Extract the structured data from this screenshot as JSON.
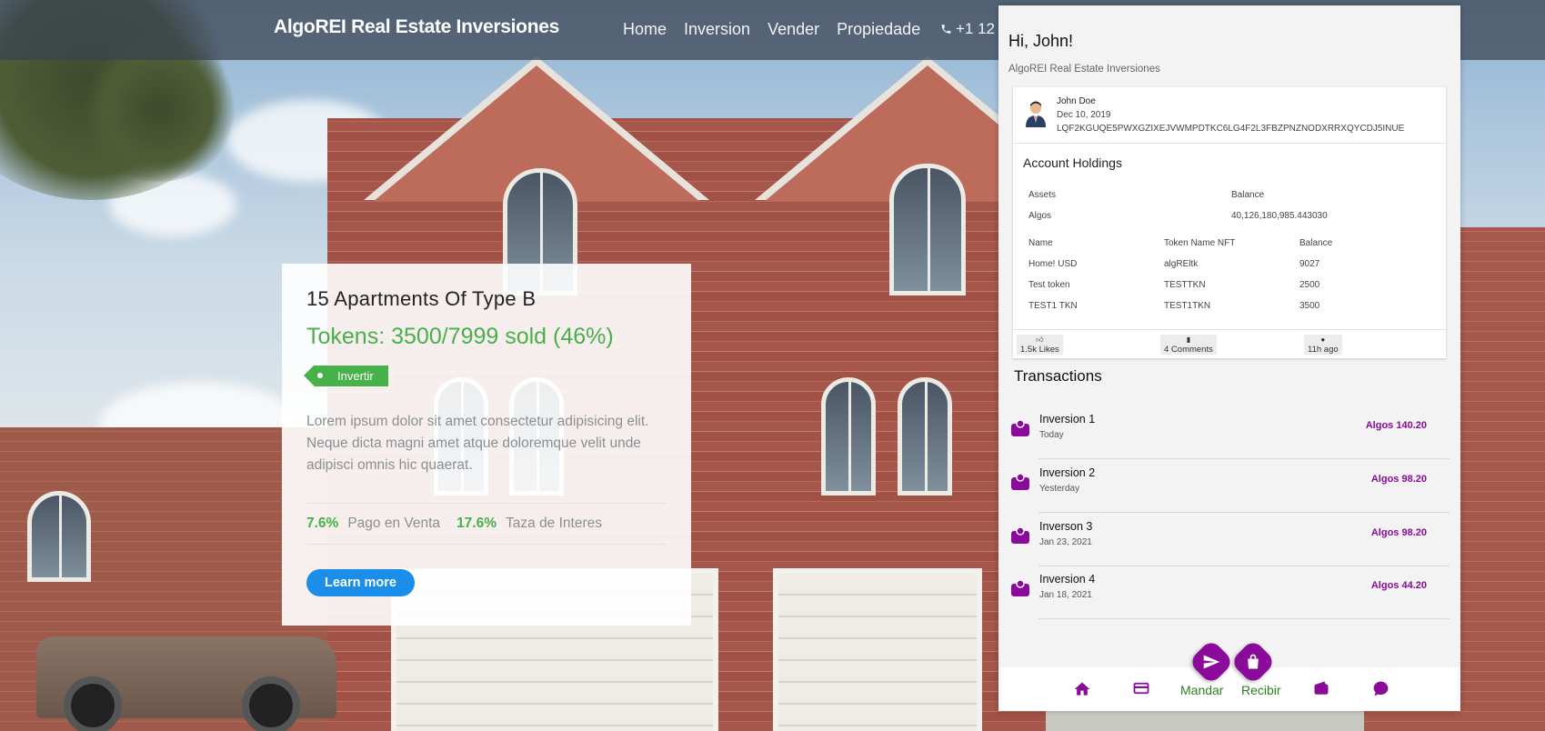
{
  "colors": {
    "accent_green": "#48b04a",
    "wallet_purple": "#8a0a9a",
    "learn_blue": "#1a8ee8",
    "nav_green": "#2b7f1e"
  },
  "header": {
    "brand": "AlgoREI Real Estate Inversiones",
    "nav": [
      "Home",
      "Inversion",
      "Vender",
      "Propiedade"
    ],
    "phone_icon": "phone-icon",
    "phone": "+1 12"
  },
  "property": {
    "title": "15 Apartments Of Type B",
    "tokens": "Tokens: 3500/7999 sold (46%)",
    "tag": "Invertir",
    "description": "Lorem ipsum dolor sit amet consectetur adipisicing elit. Neque dicta magni amet atque doloremque velit unde adipisci omnis hic quaerat.",
    "stat1_value": "7.6%",
    "stat1_label": "Pago en Venta",
    "stat2_value": "17.6%",
    "stat2_label": "Taza de Interes",
    "learn_more": "Learn more"
  },
  "wallet": {
    "greeting": "Hi, John!",
    "subtitle": "AlgoREI Real Estate Inversiones",
    "user": {
      "name": "John Doe",
      "date": "Dec 10, 2019",
      "address": "LQF2KGUQE5PWXGZIXEJVWMPDTKC6LG4F2L3FBZPNZNODXRRXQYCDJ5INUE"
    },
    "holdings_title": "Account Holdings",
    "assets_header": [
      "Assets",
      "Balance"
    ],
    "assets_row": [
      "Algos",
      "40,126,180,985.443030"
    ],
    "tokens_header": [
      "Name",
      "Token Name NFT",
      "Balance"
    ],
    "tokens": [
      [
        "Home! USD",
        "algREltk",
        "9027"
      ],
      [
        "Test token",
        "TESTTKN",
        "2500"
      ],
      [
        "TEST1 TKN",
        "TEST1TKN",
        "3500"
      ]
    ],
    "footer": {
      "likes": "1.5k Likes",
      "comments": "4 Comments",
      "time": "11h ago"
    },
    "transactions_title": "Transactions",
    "transactions": [
      {
        "name": "Inversion 1",
        "date": "Today",
        "amount": "Algos 140.20"
      },
      {
        "name": "Inversion 2",
        "date": "Yesterday",
        "amount": "Algos 98.20"
      },
      {
        "name": "Inverson 3",
        "date": "Jan 23, 2021",
        "amount": "Algos 98.20"
      },
      {
        "name": "Inversion 4",
        "date": "Jan 18, 2021",
        "amount": "Algos 44.20"
      }
    ],
    "bottom_nav": {
      "send": "Mandar",
      "receive": "Recibir"
    },
    "icons": [
      "send-icon",
      "bag-icon",
      "home-icon",
      "card-icon",
      "wallet-icon",
      "chat-icon"
    ]
  }
}
